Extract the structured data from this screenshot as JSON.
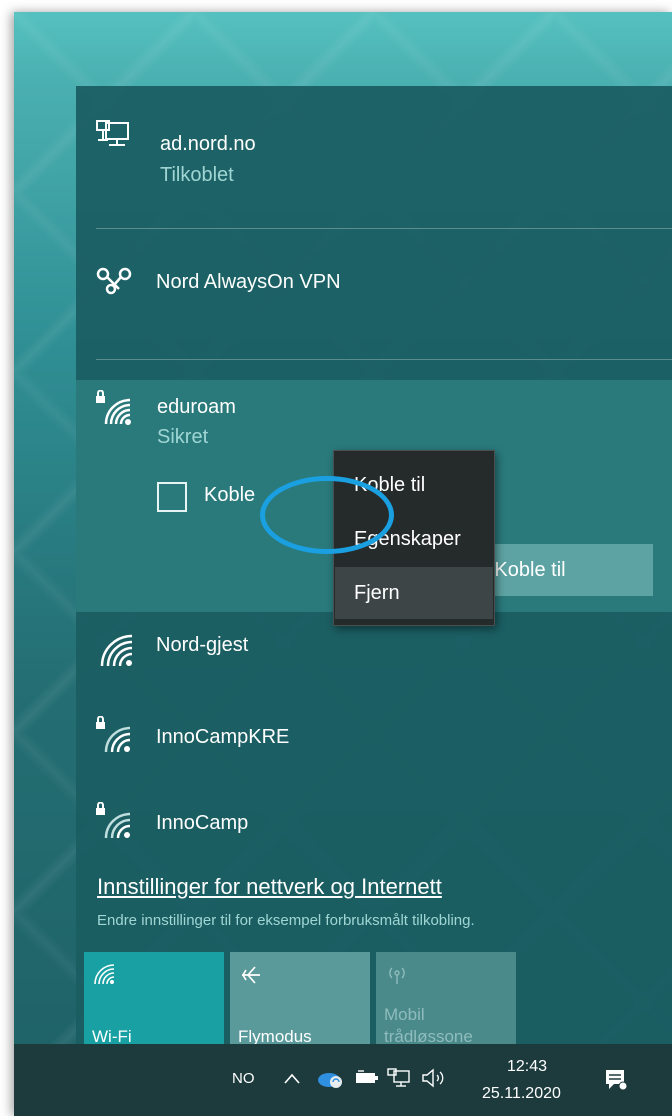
{
  "networks": {
    "wired": {
      "name": "ad.nord.no",
      "status": "Tilkoblet",
      "icon": "ethernet-icon"
    },
    "vpn": {
      "name": "Nord AlwaysOn VPN",
      "icon": "vpn-icon"
    },
    "eduroam": {
      "name": "eduroam",
      "status": "Sikret",
      "icon": "wifi-secure-icon",
      "auto_connect_label": "Koble til automatisk",
      "auto_connect_visible": "Koble ",
      "connect_label": "Koble til"
    },
    "others": [
      {
        "name": "Nord-gjest",
        "icon": "wifi-icon"
      },
      {
        "name": "InnoCampKRE",
        "icon": "wifi-secure-icon"
      },
      {
        "name": "InnoCamp",
        "icon": "wifi-secure-icon"
      }
    ]
  },
  "context_menu": {
    "items": [
      {
        "label": "Koble til"
      },
      {
        "label": "Egenskaper"
      },
      {
        "label": "Fjern",
        "highlighted": true
      }
    ]
  },
  "settings": {
    "link": "Innstillinger for nettverk og Internett",
    "description": "Endre innstillinger til for eksempel forbruksmålt tilkobling."
  },
  "quick_actions": [
    {
      "label": "Wi-Fi",
      "active": true,
      "icon": "wifi-icon"
    },
    {
      "label": "Flymodus",
      "active": false,
      "icon": "airplane-icon"
    },
    {
      "label": "Mobil\ntrådløssone",
      "label_line1": "Mobil",
      "label_line2": "trådløssone",
      "disabled": true,
      "icon": "mobile-hotspot-icon"
    }
  ],
  "taskbar": {
    "language": "NO",
    "time": "12:43",
    "date": "25.11.2020"
  },
  "colors": {
    "accent": "#19a0a3",
    "highlight_ring": "#1a9fe0",
    "menu_bg": "#252a2b"
  }
}
